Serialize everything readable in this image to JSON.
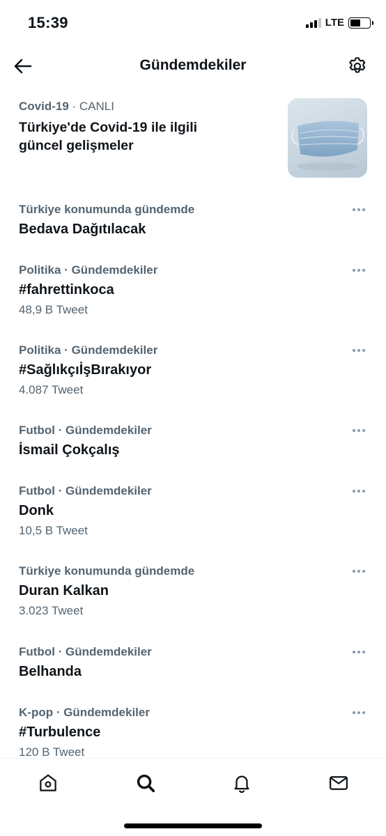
{
  "status_bar": {
    "time": "15:39",
    "network": "LTE",
    "battery_level": 0.55
  },
  "header": {
    "title": "Gündemdekiler",
    "back_icon": "arrow-left-icon",
    "settings_icon": "gear-icon"
  },
  "featured": {
    "category": "Covid-19",
    "separator": " · ",
    "status": "CANLI",
    "headline": "Türkiye'de Covid-19 ile ilgili güncel gelişmeler",
    "thumbnail": "face-mask-image"
  },
  "trends": [
    {
      "category": "Türkiye konumunda gündemde",
      "name": "Bedava Dağıtılacak",
      "count": ""
    },
    {
      "category": "Politika · Gündemdekiler",
      "name": "#fahrettinkoca",
      "count": "48,9 B Tweet"
    },
    {
      "category": "Politika · Gündemdekiler",
      "name": "#SağlıkçıİşBırakıyor",
      "count": "4.087 Tweet"
    },
    {
      "category": "Futbol · Gündemdekiler",
      "name": "İsmail Çokçalış",
      "count": ""
    },
    {
      "category": "Futbol · Gündemdekiler",
      "name": "Donk",
      "count": "10,5 B Tweet"
    },
    {
      "category": "Türkiye konumunda gündemde",
      "name": "Duran Kalkan",
      "count": "3.023 Tweet"
    },
    {
      "category": "Futbol · Gündemdekiler",
      "name": "Belhanda",
      "count": ""
    },
    {
      "category": "K-pop · Gündemdekiler",
      "name": "#Turbulence",
      "count": "120 B Tweet"
    }
  ],
  "tab_bar": {
    "tabs": [
      {
        "icon": "home-icon",
        "active": false
      },
      {
        "icon": "search-icon",
        "active": true
      },
      {
        "icon": "bell-icon",
        "active": false
      },
      {
        "icon": "mail-icon",
        "active": false
      }
    ]
  },
  "colors": {
    "text_primary": "#0f1419",
    "text_secondary": "#536471",
    "more_dots": "#8b98a5"
  }
}
